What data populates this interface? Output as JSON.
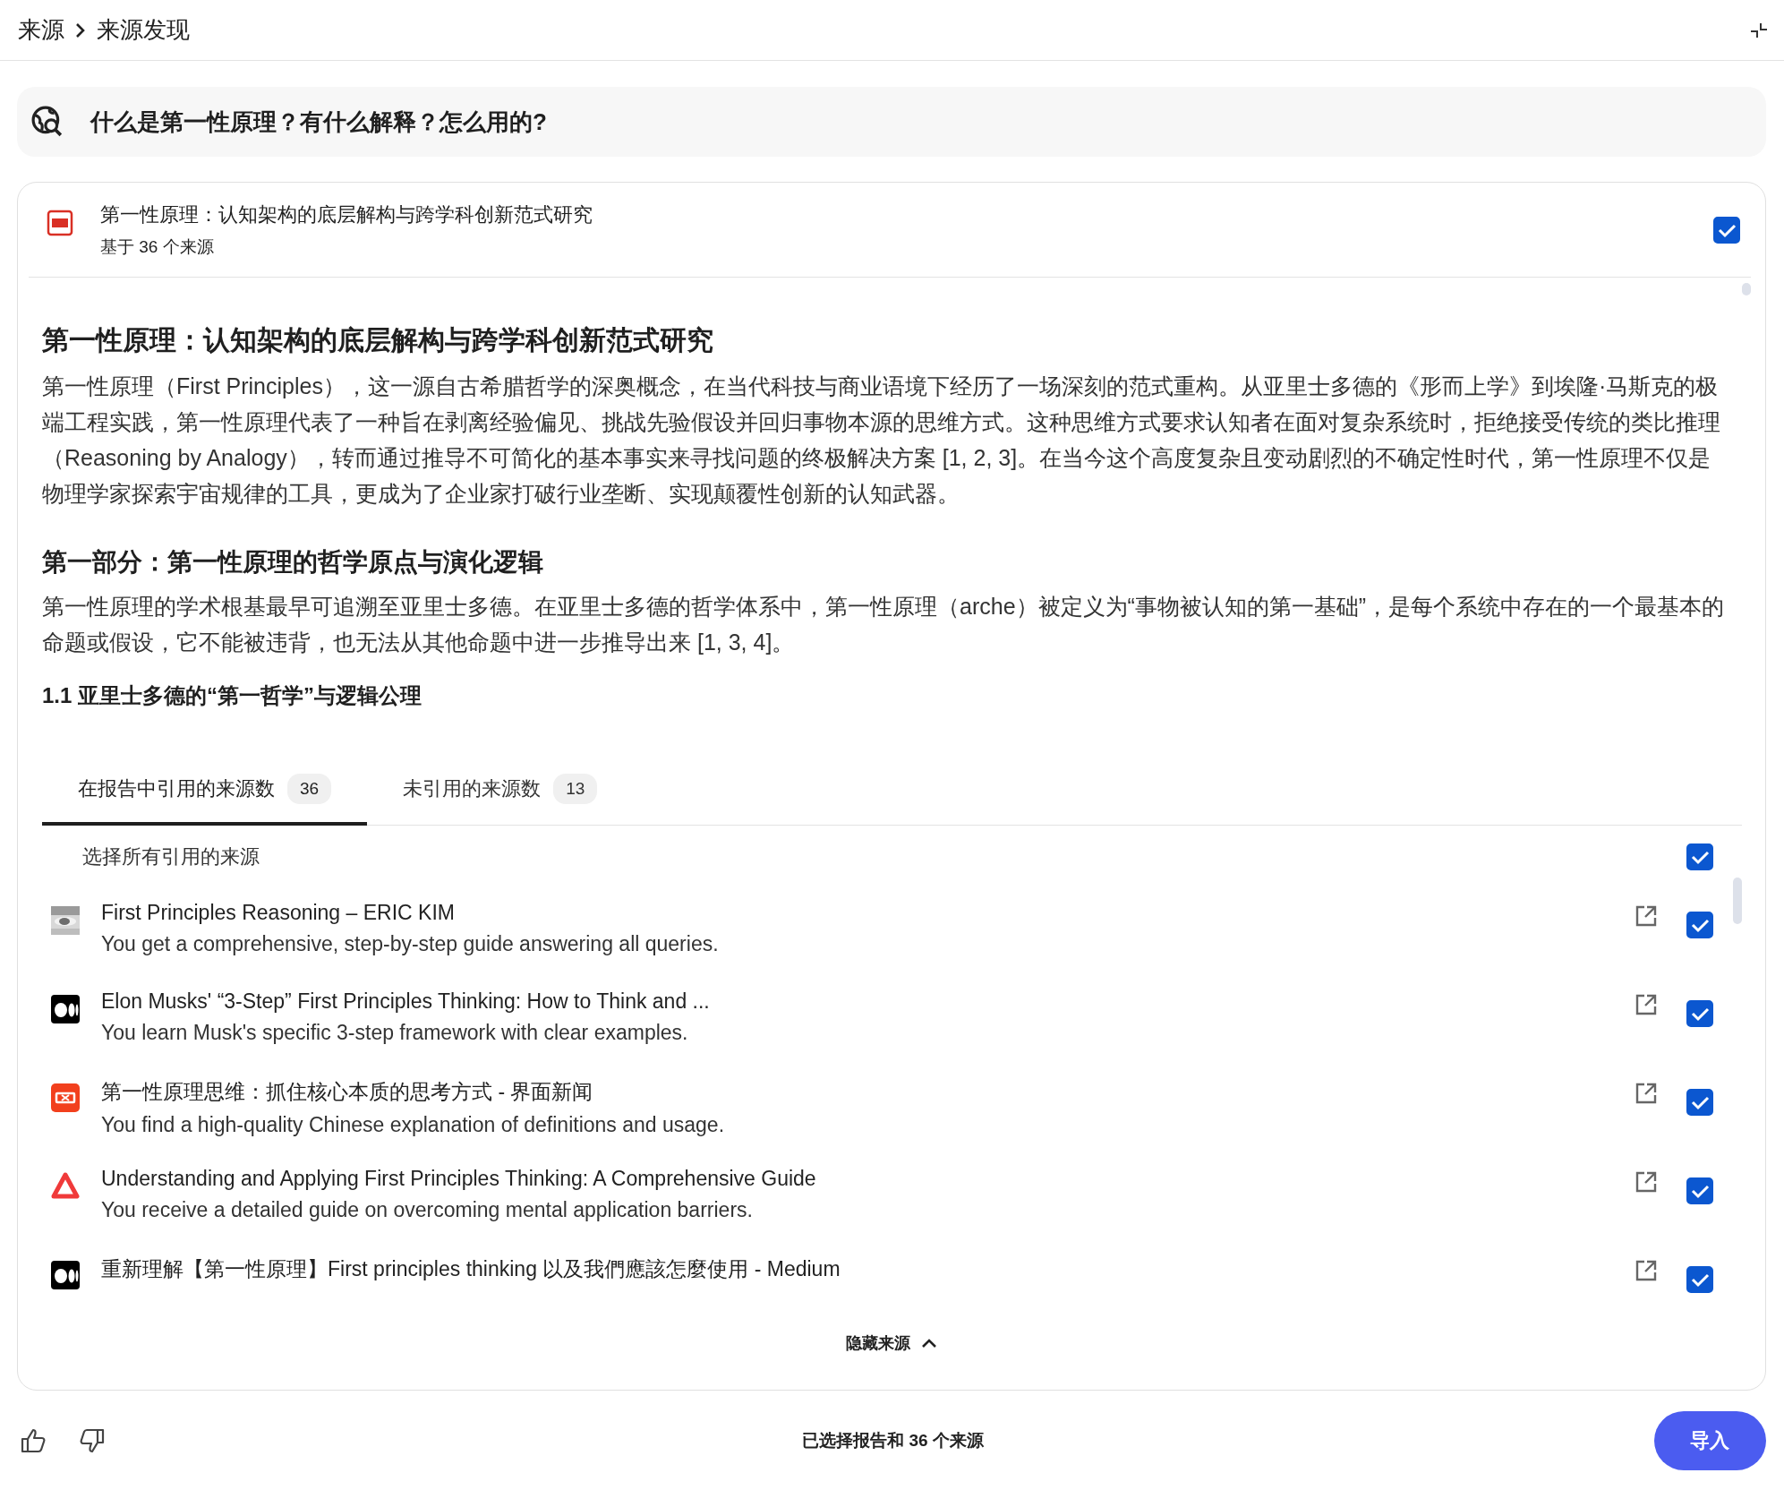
{
  "breadcrumb": [
    "来源",
    "来源发现"
  ],
  "query": "什么是第一性原理？有什么解释？怎么用的?",
  "report": {
    "title": "第一性原理：认知架构的底层解构与跨学科创新范式研究",
    "subtitle": "基于 36 个来源",
    "checked": true,
    "content": [
      {
        "kind": "h1",
        "text": "第一性原理：认知架构的底层解构与跨学科创新范式研究"
      },
      {
        "kind": "p",
        "text": "第一性原理（First Principles），这一源自古希腊哲学的深奥概念，在当代科技与商业语境下经历了一场深刻的范式重构。从亚里士多德的《形而上学》到埃隆·马斯克的极端工程实践，第一性原理代表了一种旨在剥离经验偏见、挑战先验假设并回归事物本源的思维方式。这种思维方式要求认知者在面对复杂系统时，拒绝接受传统的类比推理（Reasoning by Analogy），转而通过推导不可简化的基本事实来寻找问题的终极解决方案 [1, 2, 3]。在当今这个高度复杂且变动剧烈的不确定性时代，第一性原理不仅是物理学家探索宇宙规律的工具，更成为了企业家打破行业垄断、实现颠覆性创新的认知武器。"
      },
      {
        "kind": "h2",
        "text": "第一部分：第一性原理的哲学原点与演化逻辑"
      },
      {
        "kind": "p",
        "text": "第一性原理的学术根基最早可追溯至亚里士多德。在亚里士多德的哲学体系中，第一性原理（arche）被定义为“事物被认知的第一基础”，是每个系统中存在的一个最基本的命题或假设，它不能被违背，也无法从其他命题中进一步推导出来 [1, 3, 4]。"
      },
      {
        "kind": "h3",
        "text": "1.1 亚里士多德的“第一哲学”与逻辑公理"
      }
    ]
  },
  "tabs": [
    {
      "label": "在报告中引用的来源数",
      "count": "36",
      "selected": true
    },
    {
      "label": "未引用的来源数",
      "count": "13",
      "selected": false
    }
  ],
  "select_all": {
    "label": "选择所有引用的来源",
    "checked": true
  },
  "sources": [
    {
      "kind": "picture",
      "title": "First Principles Reasoning – ERIC KIM",
      "description": "You get a comprehensive, step-by-step guide answering all queries.",
      "checked": true
    },
    {
      "kind": "dark-logo",
      "title": "Elon Musks' “3-Step” First Principles Thinking: How to Think and ...",
      "description": "You learn Musk's specific 3-step framework with clear examples.",
      "checked": true
    },
    {
      "kind": "red-logo",
      "title": "第一性原理思维：抓住核心本质的思考方式 - 界面新闻",
      "description": "You find a high-quality Chinese explanation of definitions and usage.",
      "checked": true
    },
    {
      "kind": "triangle-logo",
      "title": "Understanding and Applying First Principles Thinking: A Comprehensive Guide",
      "description": "You receive a detailed guide on overcoming mental application barriers.",
      "checked": true
    },
    {
      "kind": "dark-logo",
      "title": "重新理解【第一性原理】First principles thinking 以及我們應該怎麼使用 - Medium",
      "checked": true
    }
  ],
  "toggle": "隐藏来源",
  "status": "已选择报告和 36 个来源",
  "import_button": "导入"
}
